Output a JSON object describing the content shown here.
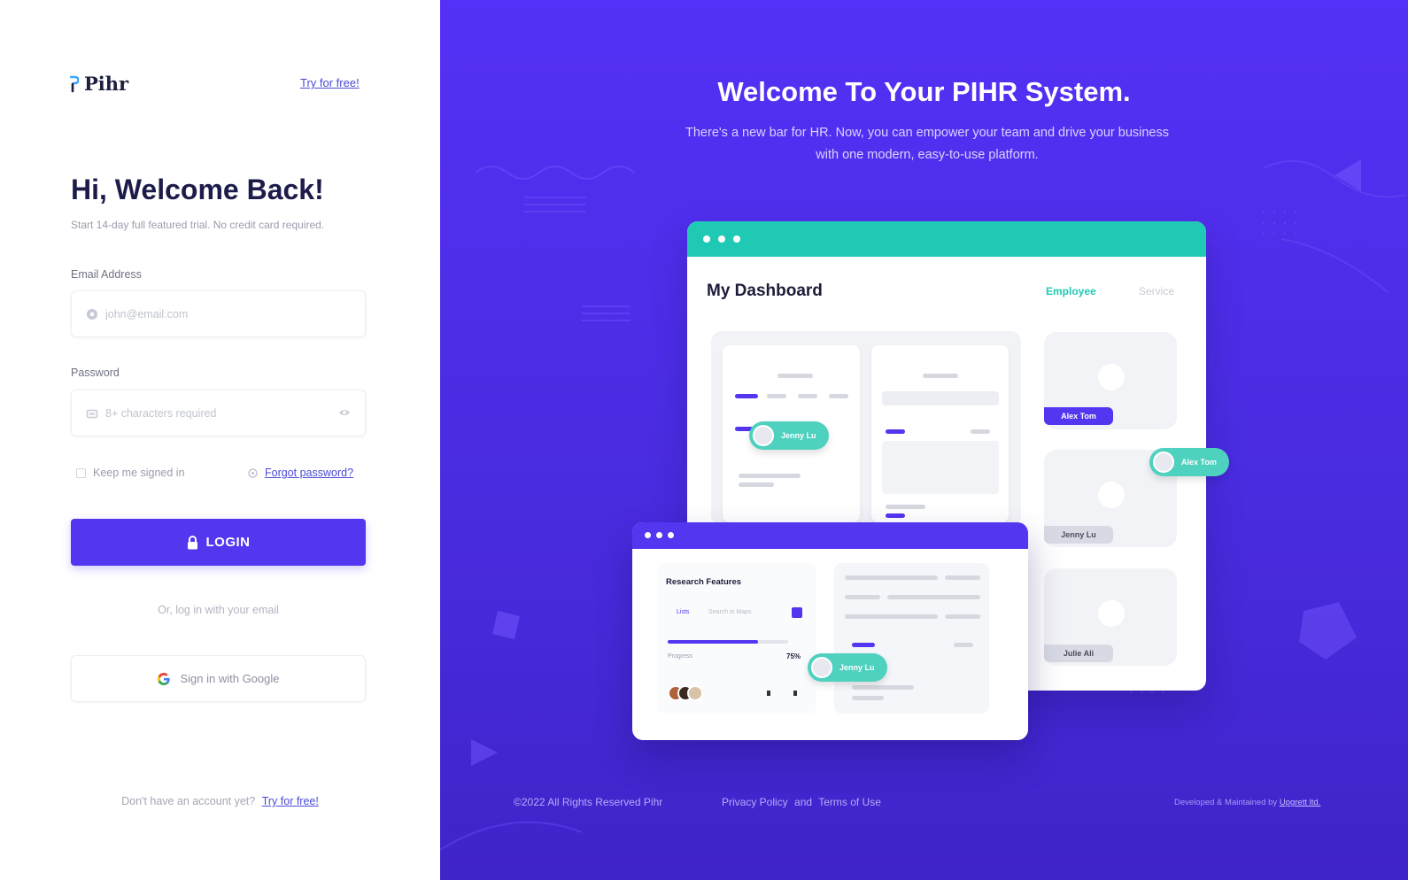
{
  "brand": {
    "name": "Pihr",
    "logo_color_a": "#3ea6ff",
    "logo_color_b": "#1c1f3d"
  },
  "left": {
    "try_link": "Try for free!",
    "heading": "Hi, Welcome Back!",
    "subheading": "Start 14-day full featured trial. No credit card required.",
    "email": {
      "label": "Email Address",
      "placeholder": "john@email.com",
      "icon": "at-sign-icon"
    },
    "password": {
      "label": "Password",
      "placeholder": "8+ characters required",
      "icon": "lock-field-icon",
      "toggle_icon": "eye-icon"
    },
    "remember_label": "Keep me signed in",
    "forgot_label": "Forgot password?",
    "login_label": "LOGIN",
    "or_text": "Or, log in with your email",
    "google_label": "Sign in with Google",
    "bottom_text": "Don't have an account yet?",
    "bottom_link": "Try for free!"
  },
  "right": {
    "title": "Welcome To Your PIHR System.",
    "subtitle": "There's a new bar for HR. Now, you can empower your team and drive your business with one modern, easy-to-use platform.",
    "dashboard": {
      "title": "My Dashboard",
      "tabs": [
        "Employee",
        "Service"
      ],
      "people": [
        "Alex Tom",
        "Jenny Lu",
        "Julie Ali"
      ],
      "pill_names": [
        "Jenny Lu",
        "Alex Tom",
        "Jenny Lu"
      ]
    },
    "research": {
      "title": "Research Features",
      "tab": "Lists",
      "search": "Search in Maps",
      "progress_label": "Progress",
      "progress_value": "75%",
      "progress": 0.75
    },
    "footer": {
      "copyright": "©2022 All Rights Reserved Pihr",
      "privacy": "Privacy Policy",
      "and": "and",
      "terms": "Terms of Use",
      "credit": "Developed & Maintained by",
      "credit_link": "Upgrett ltd."
    },
    "colors": {
      "accent": "#5236f0",
      "teal": "#20c9b4",
      "bg_top": "#5530f6",
      "bg_bottom": "#3f24c9"
    }
  }
}
